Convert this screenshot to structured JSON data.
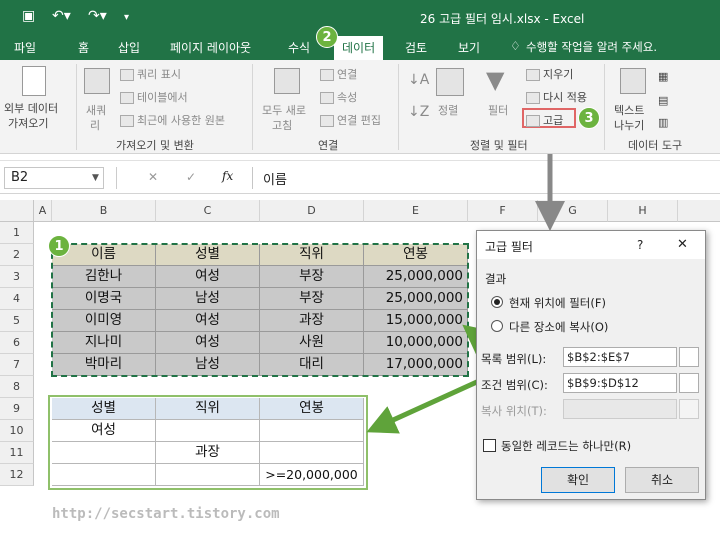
{
  "window": {
    "title": "26 고급 필터 임시.xlsx - Excel"
  },
  "tabs": {
    "file": "파일",
    "home": "홈",
    "insert": "삽입",
    "layout": "페이지 레이아웃",
    "formula": "수식",
    "data": "데이터",
    "review": "검토",
    "view": "보기",
    "tell": "수행할 작업을 알려 주세요."
  },
  "ribbon": {
    "ext_data": "외부 데이터",
    "ext_data2": "가져오기",
    "new_query": "새쿼",
    "new_query2": "리",
    "show_query": "쿼리 표시",
    "from_table": "테이블에서",
    "recent": "최근에 사용한 원본",
    "get_transform": "가져오기 및 변환",
    "refresh_all": "모두 새로",
    "refresh_all2": "고침",
    "connections": "연결",
    "properties": "속성",
    "edit_links": "연결 편집",
    "conn_group": "연결",
    "sort": "정렬",
    "filter": "필터",
    "clear": "지우기",
    "reapply": "다시 적용",
    "advanced": "고급",
    "sort_filter_group": "정렬 및 필터",
    "text_to_col": "텍스트",
    "text_to_col2": "나누기",
    "data_tools": "데이터 도구"
  },
  "formula_bar": {
    "name_box": "B2",
    "fx": "fx",
    "content": "이름"
  },
  "columns": [
    "A",
    "B",
    "C",
    "D",
    "E",
    "F",
    "G",
    "H"
  ],
  "rows": [
    "1",
    "2",
    "3",
    "4",
    "5",
    "6",
    "7",
    "8",
    "9",
    "10",
    "11",
    "12"
  ],
  "table": {
    "headers": [
      "이름",
      "성별",
      "직위",
      "연봉"
    ],
    "rows": [
      [
        "김한나",
        "여성",
        "부장",
        "25,000,000"
      ],
      [
        "이명국",
        "남성",
        "부장",
        "25,000,000"
      ],
      [
        "이미영",
        "여성",
        "과장",
        "15,000,000"
      ],
      [
        "지나미",
        "여성",
        "사원",
        "10,000,000"
      ],
      [
        "박마리",
        "남성",
        "대리",
        "17,000,000"
      ]
    ]
  },
  "criteria": {
    "headers": [
      "성별",
      "직위",
      "연봉"
    ],
    "rows": [
      [
        "여성",
        "",
        ""
      ],
      [
        "",
        "과장",
        ""
      ],
      [
        "",
        "",
        ">=20,000,000"
      ]
    ]
  },
  "dialog": {
    "title": "고급 필터",
    "help": "?",
    "close": "✕",
    "result_label": "결과",
    "opt_inplace": "현재 위치에 필터(F)",
    "opt_copy": "다른 장소에 복사(O)",
    "list_range_label": "목록 범위(L):",
    "list_range": "$B$2:$E$7",
    "criteria_range_label": "조건 범위(C):",
    "criteria_range": "$B$9:$D$12",
    "copy_to_label": "복사 위치(T):",
    "copy_to": "",
    "unique_label": "동일한 레코드는 하나만(R)",
    "ok": "확인",
    "cancel": "취소"
  },
  "badges": [
    "1",
    "2",
    "3"
  ],
  "watermark": "http://secstart.tistory.com",
  "colors": {
    "excel_green": "#217346",
    "badge_green": "#6cb33f",
    "arrow_green": "#5fa33a",
    "header_tan": "#ddd9c3",
    "data_gray": "#c9c9c9",
    "criteria_blue": "#dce6f1"
  }
}
